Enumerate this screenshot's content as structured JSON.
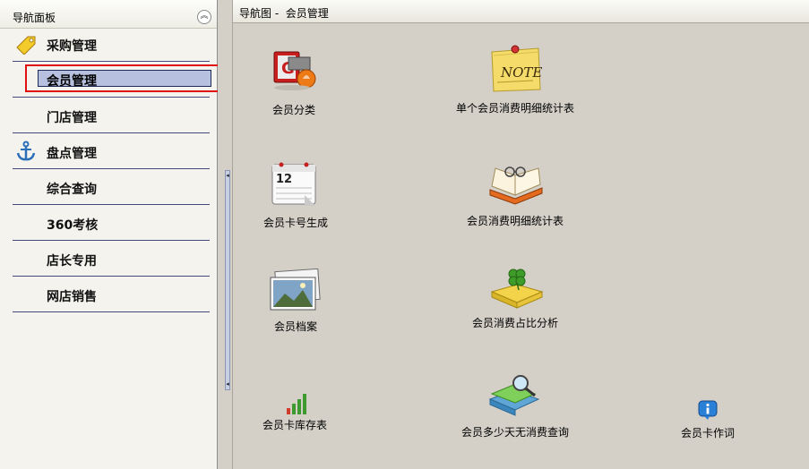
{
  "nav": {
    "title": "导航面板",
    "collapse_glyph": "︽",
    "items": [
      {
        "label": "采购管理",
        "icon": "tag-icon"
      },
      {
        "label": "会员管理",
        "icon": ""
      },
      {
        "label": "门店管理",
        "icon": ""
      },
      {
        "label": "盘点管理",
        "icon": "anchor-icon"
      },
      {
        "label": "综合查询",
        "icon": ""
      },
      {
        "label": "360考核",
        "icon": ""
      },
      {
        "label": "店长专用",
        "icon": ""
      },
      {
        "label": "网店销售",
        "icon": ""
      }
    ],
    "selected": "会员管理"
  },
  "breadcrumb": {
    "root": "导航图",
    "separator": " -  ",
    "current": "会员管理"
  },
  "tiles": [
    {
      "label": "会员分类",
      "icon": "member-category-icon"
    },
    {
      "label": "单个会员消费明细统计表",
      "icon": "note-icon"
    },
    {
      "label": "会员卡号生成",
      "icon": "calendar-icon"
    },
    {
      "label": "会员消费明细统计表",
      "icon": "open-book-glasses-icon"
    },
    {
      "label": "会员档案",
      "icon": "photo-archive-icon"
    },
    {
      "label": "会员消费占比分析",
      "icon": "clover-book-icon"
    },
    {
      "label": "会员卡库存表",
      "icon": "bar-chart-icon"
    },
    {
      "label": "会员多少天无消费查询",
      "icon": "books-magnifier-icon"
    },
    {
      "label": "会员卡作词",
      "icon": "info-icon"
    }
  ],
  "colors": {
    "panel_bg": "#f4f3ee",
    "selected_bg": "#b7c1df",
    "highlight": "#e01010",
    "separator": "#3d4a7a",
    "workspace_bg": "#d4d0c8"
  }
}
